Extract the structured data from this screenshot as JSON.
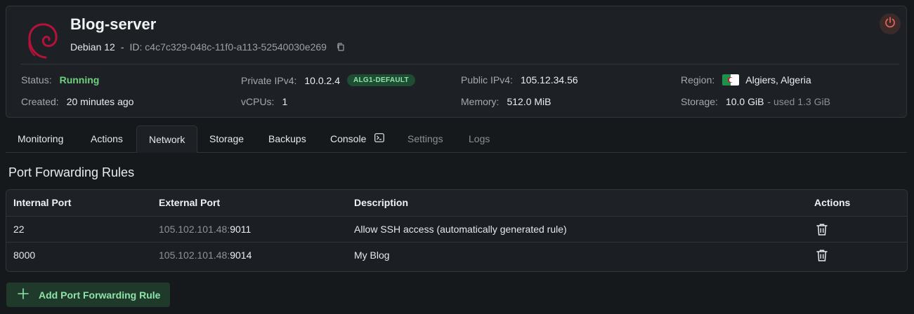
{
  "server": {
    "name": "Blog-server",
    "os": "Debian 12",
    "dash": "-",
    "id_label": "ID:",
    "id": "c4c7c329-048c-11f0-a113-52540030e269"
  },
  "icons": {
    "logo": "debian-logo-icon",
    "copy": "copy-icon",
    "power": "power-icon",
    "flag": "algeria-flag-icon",
    "console": "terminal-icon",
    "delete": "trash-icon",
    "add": "plus-icon"
  },
  "colors": {
    "accent_green": "#6fd07e",
    "debian_red": "#b5123a",
    "power_red": "#e0605a"
  },
  "info": {
    "status_label": "Status:",
    "status_value": "Running",
    "created_label": "Created:",
    "created_value": "20 minutes ago",
    "private_ipv4_label": "Private IPv4:",
    "private_ipv4_value": "10.0.2.4",
    "private_badge": "ALG1-DEFAULT",
    "vcpus_label": "vCPUs:",
    "vcpus_value": "1",
    "public_ipv4_label": "Public IPv4:",
    "public_ipv4_value": "105.12.34.56",
    "memory_label": "Memory:",
    "memory_value": "512.0 MiB",
    "region_label": "Region:",
    "region_value": "Algiers, Algeria",
    "storage_label": "Storage:",
    "storage_value": "10.0 GiB",
    "storage_used": "- used 1.3 GiB"
  },
  "tabs": [
    {
      "label": "Monitoring"
    },
    {
      "label": "Actions"
    },
    {
      "label": "Network"
    },
    {
      "label": "Storage"
    },
    {
      "label": "Backups"
    },
    {
      "label": "Console"
    },
    {
      "label": "Settings"
    },
    {
      "label": "Logs"
    }
  ],
  "port_forwarding": {
    "title": "Port Forwarding Rules",
    "columns": [
      "Internal Port",
      "External Port",
      "Description",
      "Actions"
    ],
    "rows": [
      {
        "internal": "22",
        "external_ip": "105.102.101.48:",
        "external_port": "9011",
        "description": "Allow SSH access (automatically generated rule)"
      },
      {
        "internal": "8000",
        "external_ip": "105.102.101.48:",
        "external_port": "9014",
        "description": "My Blog"
      }
    ],
    "add_button": "Add Port Forwarding Rule"
  }
}
